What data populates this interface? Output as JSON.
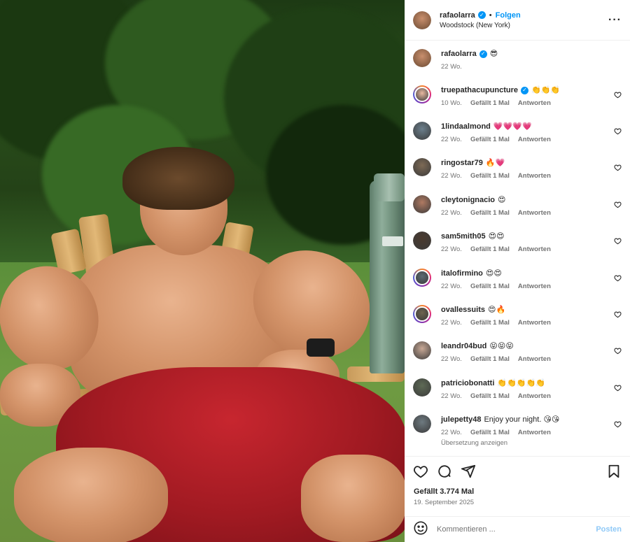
{
  "post": {
    "username": "rafaolarra",
    "follow_label": "Folgen",
    "location": "Woodstock (New York)",
    "caption_emoji": "😎",
    "caption_time": "22 Wo.",
    "likes": "Gefällt 3.774 Mal",
    "date": "19. September 2025"
  },
  "comments": [
    {
      "user": "truepathacupuncture",
      "verified": true,
      "text": "👏👏👏",
      "time": "10 Wo.",
      "likes": "Gefällt 1 Mal",
      "reply": "Antworten",
      "ring": true,
      "color": "#e8b9a0"
    },
    {
      "user": "1lindaalmond",
      "verified": false,
      "text": "💗💗💗💗",
      "time": "22 Wo.",
      "likes": "Gefällt 1 Mal",
      "reply": "Antworten",
      "ring": false,
      "color": "#6b7f8c"
    },
    {
      "user": "ringostar79",
      "verified": false,
      "text": "🔥💗",
      "time": "22 Wo.",
      "likes": "Gefällt 1 Mal",
      "reply": "Antworten",
      "ring": false,
      "color": "#7d6a55"
    },
    {
      "user": "cleytonignacio",
      "verified": false,
      "text": "😍",
      "time": "22 Wo.",
      "likes": "Gefällt 1 Mal",
      "reply": "Antworten",
      "ring": false,
      "color": "#b07a62"
    },
    {
      "user": "sam5mith05",
      "verified": false,
      "text": "😍😍",
      "time": "22 Wo.",
      "likes": "Gefällt 1 Mal",
      "reply": "Antworten",
      "ring": false,
      "color": "#4a3a2e"
    },
    {
      "user": "italofirmino",
      "verified": false,
      "text": "😍😍",
      "time": "22 Wo.",
      "likes": "Gefällt 1 Mal",
      "reply": "Antworten",
      "ring": true,
      "color": "#5c6b74"
    },
    {
      "user": "ovallessuits",
      "verified": false,
      "text": "😍🔥",
      "time": "22 Wo.",
      "likes": "Gefällt 1 Mal",
      "reply": "Antworten",
      "ring": true,
      "color": "#6d6450"
    },
    {
      "user": "leandr04bud",
      "verified": false,
      "text": "😝😝😝",
      "time": "22 Wo.",
      "likes": "Gefällt 1 Mal",
      "reply": "Antworten",
      "ring": false,
      "color": "#c9a996"
    },
    {
      "user": "patriciobonatti",
      "verified": false,
      "text": "👏👏👏👏👏",
      "time": "22 Wo.",
      "likes": "Gefällt 1 Mal",
      "reply": "Antworten",
      "ring": false,
      "color": "#5e6a55"
    },
    {
      "user": "julepetty48",
      "verified": false,
      "text": "Enjoy your night. 😘😘",
      "time": "22 Wo.",
      "likes": "Gefällt 1 Mal",
      "reply": "Antworten",
      "ring": false,
      "color": "#6e7a80",
      "translate": "Übersetzung anzeigen"
    }
  ],
  "composer": {
    "placeholder": "Kommentieren ...",
    "post_label": "Posten"
  },
  "icons": {
    "more": "more-options-icon",
    "like": "heart-icon",
    "comment": "comment-icon",
    "share": "share-icon",
    "save": "bookmark-icon",
    "emoji": "emoji-icon"
  },
  "colors": {
    "accent": "#0095f6",
    "muted": "#737373",
    "post_disabled": "#8fc9f7"
  }
}
